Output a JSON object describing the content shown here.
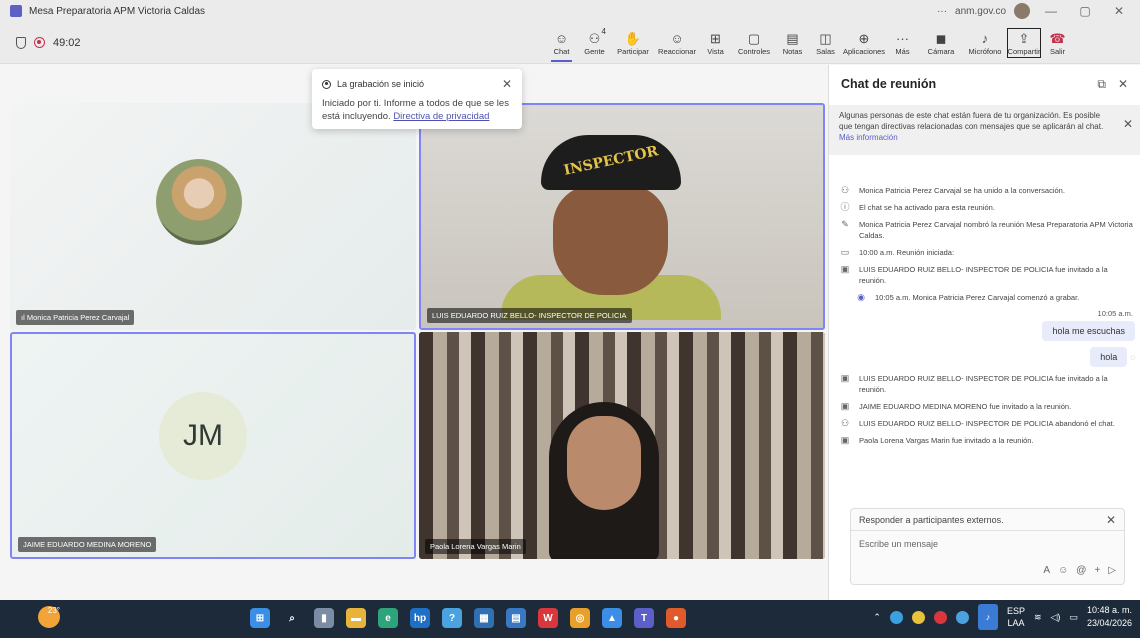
{
  "window": {
    "title": "Mesa Preparatoria APM Victoria Caldas",
    "domain": "anm.gov.co",
    "more": "···",
    "minimize": "—",
    "restore": "▢",
    "close": "✕"
  },
  "meeting": {
    "timer": "49:02"
  },
  "toolbar": [
    {
      "id": "chat",
      "label": "Chat",
      "icon": "☺"
    },
    {
      "id": "people",
      "label": "Gente",
      "icon": "⚇",
      "count": "4"
    },
    {
      "id": "raise",
      "label": "Participar",
      "icon": "✋"
    },
    {
      "id": "react",
      "label": "Reaccionar",
      "icon": "☺"
    },
    {
      "id": "view",
      "label": "Vista",
      "icon": "⊞"
    },
    {
      "id": "controls",
      "label": "Controles",
      "icon": "▢"
    },
    {
      "id": "notes",
      "label": "Notas",
      "icon": "▤"
    },
    {
      "id": "rooms",
      "label": "Salas",
      "icon": "◫"
    },
    {
      "id": "apps",
      "label": "Aplicaciones",
      "icon": "⊕"
    },
    {
      "id": "more",
      "label": "Más",
      "icon": "···"
    },
    {
      "id": "camera",
      "label": "Cámara",
      "icon": "◼"
    },
    {
      "id": "mic",
      "label": "Micrófono",
      "icon": "♪"
    },
    {
      "id": "share",
      "label": "Compartir",
      "icon": "⇪"
    },
    {
      "id": "leave",
      "label": "Salir",
      "icon": "☎"
    }
  ],
  "toast": {
    "title": "La grabación se inició",
    "body": "Iniciado por ti. Informe a todos de que se les está incluyendo.",
    "link": "Directiva de privacidad"
  },
  "participants": [
    {
      "name": "Monica Patricia Perez Carvajal",
      "icon": "ıl"
    },
    {
      "name": "LUIS EDUARDO RUIZ BELLO- INSPECTOR DE POLICIA",
      "cap_text": "INSPECTOR"
    },
    {
      "name": "JAIME EDUARDO MEDINA MORENO",
      "initials": "JM"
    },
    {
      "name": "Paola Lorena Vargas Marin"
    }
  ],
  "chat": {
    "title": "Chat de reunión",
    "banner": "Algunas personas de este chat están fuera de tu organización. Es posible que tengan directivas relacionadas con mensajes que se aplicarán al chat.",
    "banner_link": "Más información",
    "events_top": [
      {
        "icon": "⚇",
        "text": "Monica Patricia Perez Carvajal se ha unido a la conversación."
      },
      {
        "icon": "ⓘ",
        "text": "El chat se ha activado para esta reunión."
      },
      {
        "icon": "✎",
        "text": "Monica Patricia Perez Carvajal nombró la reunión Mesa Preparatoria APM Victoria Caldas."
      },
      {
        "icon": "▭",
        "text": "10:00 a.m.   Reunión iniciada:"
      },
      {
        "icon": "▣",
        "text": "LUIS EDUARDO RUIZ BELLO- INSPECTOR DE POLICIA fue invitado a la reunión."
      },
      {
        "icon": "◉",
        "text": "10:05 a.m.   Monica Patricia Perez Carvajal comenzó a grabar."
      }
    ],
    "msg_time": "10:05 a.m.",
    "messages": [
      "hola me escuchas",
      "hola"
    ],
    "events_bottom": [
      {
        "icon": "▣",
        "text": "LUIS EDUARDO RUIZ BELLO- INSPECTOR DE POLICIA fue invitado a la reunión."
      },
      {
        "icon": "▣",
        "text": "JAIME EDUARDO MEDINA MORENO fue invitado a la reunión."
      },
      {
        "icon": "⚇",
        "text": "LUIS EDUARDO RUIZ BELLO- INSPECTOR DE POLICIA abandonó el chat."
      },
      {
        "icon": "▣",
        "text": "Paola Lorena Vargas Marin fue invitado a la reunión."
      }
    ],
    "reply_label": "Responder a participantes externos.",
    "input_placeholder": "Escribe un mensaje"
  },
  "taskbar": {
    "weather": "23°",
    "lang1": "ESP",
    "lang2": "LAA",
    "time": "10:48 a. m.",
    "date": "23/04/2026",
    "colors": {
      "bg": "#1c2a3a"
    }
  }
}
